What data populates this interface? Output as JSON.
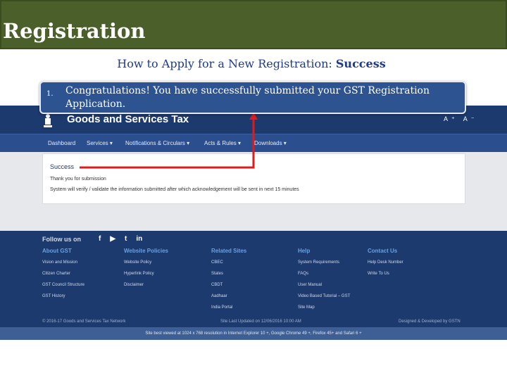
{
  "slide": {
    "title": "Registration",
    "subtitle_prefix": "How to Apply for a New Registration: ",
    "subtitle_emphasis": "Success"
  },
  "callout": {
    "number": "1.",
    "text": "Congratulations! You have successfully submitted your GST Registration Application."
  },
  "portal": {
    "brand": "Goods and Services Tax",
    "header_icons": "A⁺ A⁻",
    "nav": [
      {
        "label": "Dashboard"
      },
      {
        "label": "Services ▾"
      },
      {
        "label": "Notifications & Circulars ▾"
      },
      {
        "label": "Acts & Rules ▾"
      },
      {
        "label": "Downloads ▾"
      }
    ],
    "panel": {
      "heading": "Success",
      "line1": "Thank you for submission",
      "line2": "System will verify / validate the information submitted after which acknowledgement will be sent in next 15 minutes"
    }
  },
  "footer": {
    "follow_label": "Follow us on",
    "social_icons": [
      "f",
      "▶",
      "t",
      "in"
    ],
    "columns": [
      {
        "heading": "About GST",
        "links": [
          "Vision and Mission",
          "Citizen Charter",
          "GST Council Structure",
          "GST History"
        ]
      },
      {
        "heading": "Website Policies",
        "links": [
          "Website Policy",
          "Hyperlink Policy",
          "Disclaimer"
        ]
      },
      {
        "heading": "Related Sites",
        "links": [
          "CBEC",
          "States",
          "CBDT",
          "Aadhaar",
          "India Portal"
        ]
      },
      {
        "heading": "Help",
        "links": [
          "System Requirements",
          "FAQs",
          "User Manual",
          "Video Based Tutorial – GST",
          "Site Map"
        ]
      },
      {
        "heading": "Contact Us",
        "links": [
          "Help Desk Number",
          "Write To Us"
        ]
      }
    ],
    "copyright": "© 2016-17 Goods and Services Tax Network",
    "last_updated": "Site Last Updated on 12/06/2016 10:00 AM",
    "developed_by": "Designed & Developed by GSTN",
    "best_view": "Site best viewed at 1024 x 768 resolution in Internet Explorer 10 +, Google Chrome 49 +, Firefox 45+ and Safari 6 +"
  },
  "colors": {
    "title_bar": "#4a5f2a",
    "portal_header": "#1d3a6e",
    "navbar": "#2b4e8e",
    "callout": "#2d5390",
    "arrow": "#e01b1b"
  }
}
